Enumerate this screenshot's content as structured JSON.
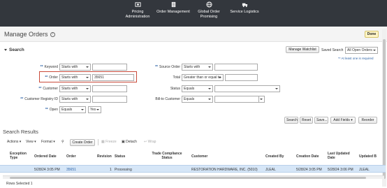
{
  "nav": {
    "items": [
      {
        "label_line1": "Pricing",
        "label_line2": "Administration",
        "icon": "pricing-icon"
      },
      {
        "label_line1": "Order Management",
        "label_line2": "",
        "icon": "document-icon"
      },
      {
        "label_line1": "Global Order",
        "label_line2": "Promising",
        "icon": "globe-icon"
      },
      {
        "label_line1": "Service Logistics",
        "label_line2": "",
        "icon": "truck-icon"
      }
    ]
  },
  "page": {
    "title": "Manage Orders",
    "done_label": "Done"
  },
  "search": {
    "header": "Search",
    "manage_watchlist": "Manage Watchlist",
    "saved_search_label": "Saved Search",
    "saved_search_value": "All Open Orders",
    "required_note": "** At least one is required",
    "fields": {
      "keyword": {
        "label": "Keyword",
        "operator": "Starts with",
        "value": ""
      },
      "order": {
        "label": "Order",
        "operator": "Starts with",
        "value": "35651"
      },
      "customer": {
        "label": "Customer",
        "operator": "Starts with",
        "value": ""
      },
      "customer_registry": {
        "label": "Customer Registry ID",
        "operator": "Starts with",
        "value": ""
      },
      "open": {
        "label": "Open",
        "operator": "Equals",
        "value": "Yes"
      },
      "source_order": {
        "label": "Source Order",
        "operator": "Starts with",
        "value": ""
      },
      "total": {
        "label": "Total",
        "operator": "Greater than or equal to",
        "value": ""
      },
      "status": {
        "label": "Status",
        "operator": "Equals",
        "value": ""
      },
      "bill_to": {
        "label": "Bill-to Customer",
        "operator": "Equals",
        "value": ""
      }
    },
    "buttons": {
      "search": "Search",
      "reset": "Reset",
      "save": "Save...",
      "add_fields": "Add Fields",
      "reorder": "Reorder"
    }
  },
  "results": {
    "title": "Search Results",
    "toolbar": {
      "actions": "Actions",
      "view": "View",
      "format": "Format",
      "create_order": "Create Order",
      "freeze": "Freeze",
      "detach": "Detach",
      "wrap": "Wrap"
    },
    "columns": [
      "Exception Type",
      "Ordered Date",
      "Order",
      "Revision",
      "Status",
      "Trade Compliance Status",
      "Customer",
      "Created By",
      "Creation Date",
      "Last Updated Date",
      "Updated B"
    ],
    "rows": [
      {
        "exception_type": "",
        "ordered_date": "5/28/24 3:05 PM",
        "order": "35651",
        "revision": "1",
        "status": "Processing",
        "trade_compliance": "",
        "customer": "RESTORATION HARDWARE, INC. (5010)",
        "created_by": "JLEAL",
        "creation_date": "5/28/24 3:05 PM",
        "last_updated": "5/28/24 3:06 PM",
        "updated_by": "JLEAL"
      }
    ],
    "rows_selected": "Rows Selected 1"
  }
}
